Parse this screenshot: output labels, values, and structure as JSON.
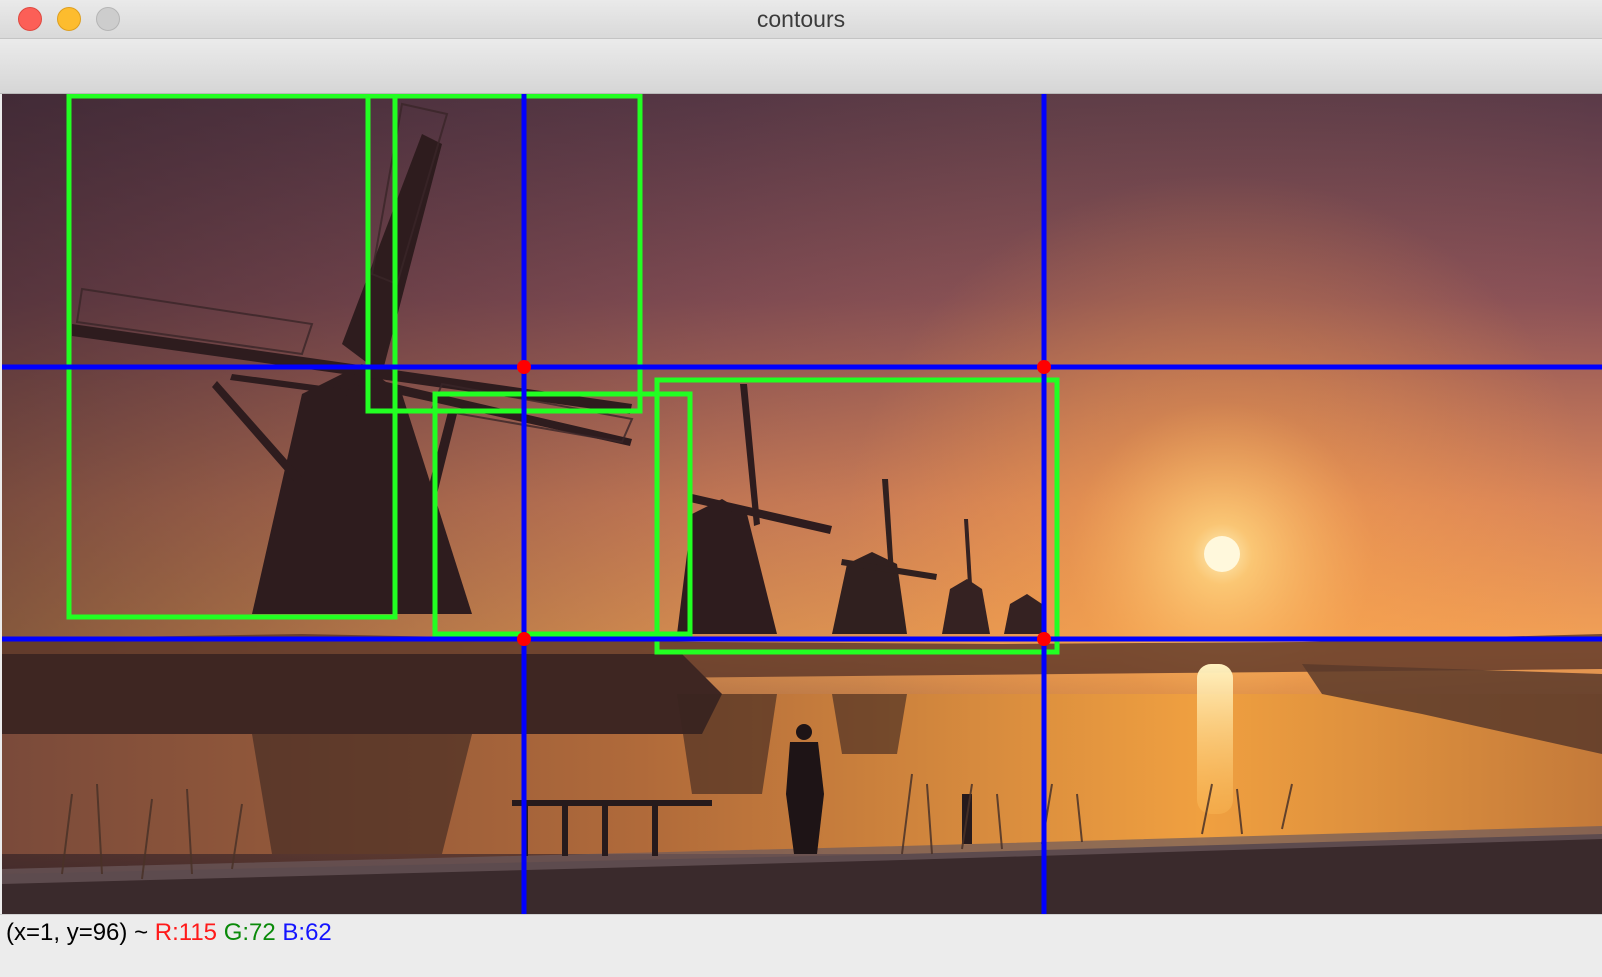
{
  "window": {
    "title": "contours",
    "buttons": {
      "close": "close-button",
      "minimize": "minimize-button",
      "zoom": "zoom-button"
    }
  },
  "image": {
    "scene": "windmills-at-sunset",
    "overlay_colors": {
      "bounding_box": "#22ff22",
      "grid_line": "#0000ff",
      "intersection_marker": "#ff0000"
    }
  },
  "status": {
    "coords": "(x=1, y=96) ~",
    "r": "R:115",
    "g": "G:72",
    "b": "B:62",
    "colors": {
      "r": "#ff1a1a",
      "g": "#0a8a0a",
      "b": "#1414ff"
    }
  }
}
